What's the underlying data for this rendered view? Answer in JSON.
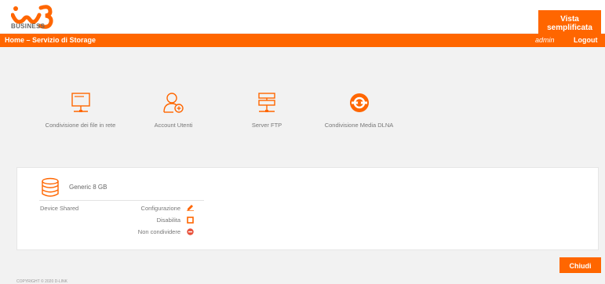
{
  "brand": {
    "logo_sub": "BUSINESS"
  },
  "header": {
    "view_button": "Vista semplificata"
  },
  "nav": {
    "title": "Home – Servizio di Storage",
    "user": "admin",
    "logout": "Logout"
  },
  "services": [
    {
      "label": "Condivisione dei file in rete",
      "icon": "monitor-share-icon"
    },
    {
      "label": "Account Utenti",
      "icon": "user-add-icon"
    },
    {
      "label": "Server FTP",
      "icon": "server-icon"
    },
    {
      "label": "Condivisione Media DLNA",
      "icon": "dlna-icon"
    }
  ],
  "storage": {
    "device_name": "Generic 8 GB",
    "status": "Device Shared",
    "actions": {
      "configure": "Configurazione",
      "disable": "Disabilita",
      "unshare": "Non condividere"
    }
  },
  "footer": {
    "close_button": "Chiudi",
    "copyright": "COPYRIGHT © 2020 D-LINK"
  },
  "colors": {
    "accent": "#ff6600",
    "unshare": "#e8503a"
  }
}
